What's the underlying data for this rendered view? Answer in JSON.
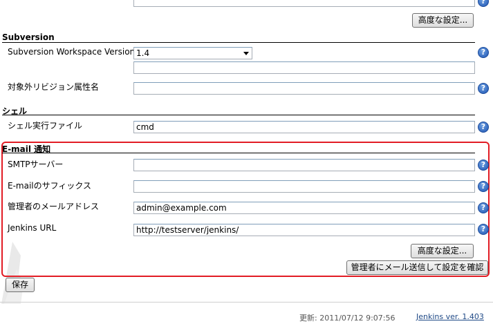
{
  "top": {
    "advanced_button": "高度な設定..."
  },
  "subversion": {
    "title": "Subversion",
    "workspace_version_label": "Subversion Workspace Version",
    "workspace_version_value": "1.4",
    "excluded_revprop_label": "対象外リビジョン属性名",
    "excluded_revprop_value": ""
  },
  "shell": {
    "title": "シェル",
    "executable_label": "シェル実行ファイル",
    "executable_value": "cmd"
  },
  "email": {
    "title": "E-mail 通知",
    "smtp_label": "SMTPサーバー",
    "smtp_value": "",
    "suffix_label": "E-mailのサフィックス",
    "suffix_value": "",
    "admin_label": "管理者のメールアドレス",
    "admin_value": "admin@example.com",
    "url_label": "Jenkins URL",
    "url_value": "http://testserver/jenkins/",
    "advanced_button": "高度な設定...",
    "test_button": "管理者にメール送信して設定を確認"
  },
  "save_button": "保存",
  "help_glyph": "?",
  "footer": {
    "updated": "更新: 2011/07/12 9:07:56",
    "version_link": "Jenkins ver. 1.403"
  },
  "colors": {
    "highlight": "#e21b23",
    "help_icon": "#2a62c0",
    "link": "#204a87"
  }
}
